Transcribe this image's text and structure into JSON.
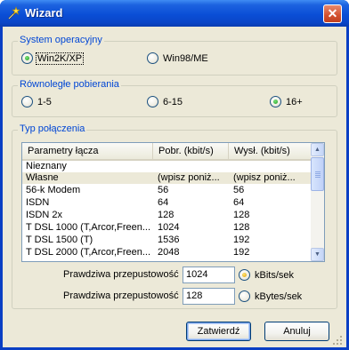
{
  "window": {
    "title": "Wizard",
    "close_label": "✕"
  },
  "os_group": {
    "label": "System operacyjny",
    "options": [
      {
        "label": "Win2K/XP",
        "selected": true
      },
      {
        "label": "Win98/ME",
        "selected": false
      }
    ]
  },
  "download_group": {
    "label": "Równoległe pobierania",
    "options": [
      {
        "label": "1-5",
        "selected": false
      },
      {
        "label": "6-15",
        "selected": false
      },
      {
        "label": "16+",
        "selected": true
      }
    ]
  },
  "connection_group": {
    "label": "Typ połączenia",
    "columns": [
      "Parametry łącza",
      "Pobr. (kbit/s)",
      "Wysł. (kbit/s)"
    ],
    "rows": [
      [
        "Nieznany",
        "",
        ""
      ],
      [
        "Własne",
        "(wpisz poniż...",
        "(wpisz poniż..."
      ],
      [
        "56-k Modem",
        "56",
        "56"
      ],
      [
        "ISDN",
        "64",
        "64"
      ],
      [
        "ISDN 2x",
        "128",
        "128"
      ],
      [
        "T DSL 1000 (T,Arcor,Freen...",
        "1024",
        "128"
      ],
      [
        "T DSL 1500 (T)",
        "1536",
        "192"
      ],
      [
        "T DSL 2000 (T,Arcor,Freen...",
        "2048",
        "192"
      ]
    ],
    "selected_row": 1,
    "download_label": "Prawdziwa przepustowość",
    "download_value": "1024",
    "upload_label": "Prawdziwa przepustowość",
    "upload_value": "128",
    "unit_options": [
      {
        "label": "kBits/sek",
        "selected": true
      },
      {
        "label": "kBytes/sek",
        "selected": false
      }
    ]
  },
  "buttons": {
    "ok_label": "Zatwierdź",
    "cancel_label": "Anuluj"
  },
  "colors": {
    "titlebar": "#0a4ed6",
    "group_label": "#0046d5",
    "dialog_bg": "#ece9d8"
  }
}
